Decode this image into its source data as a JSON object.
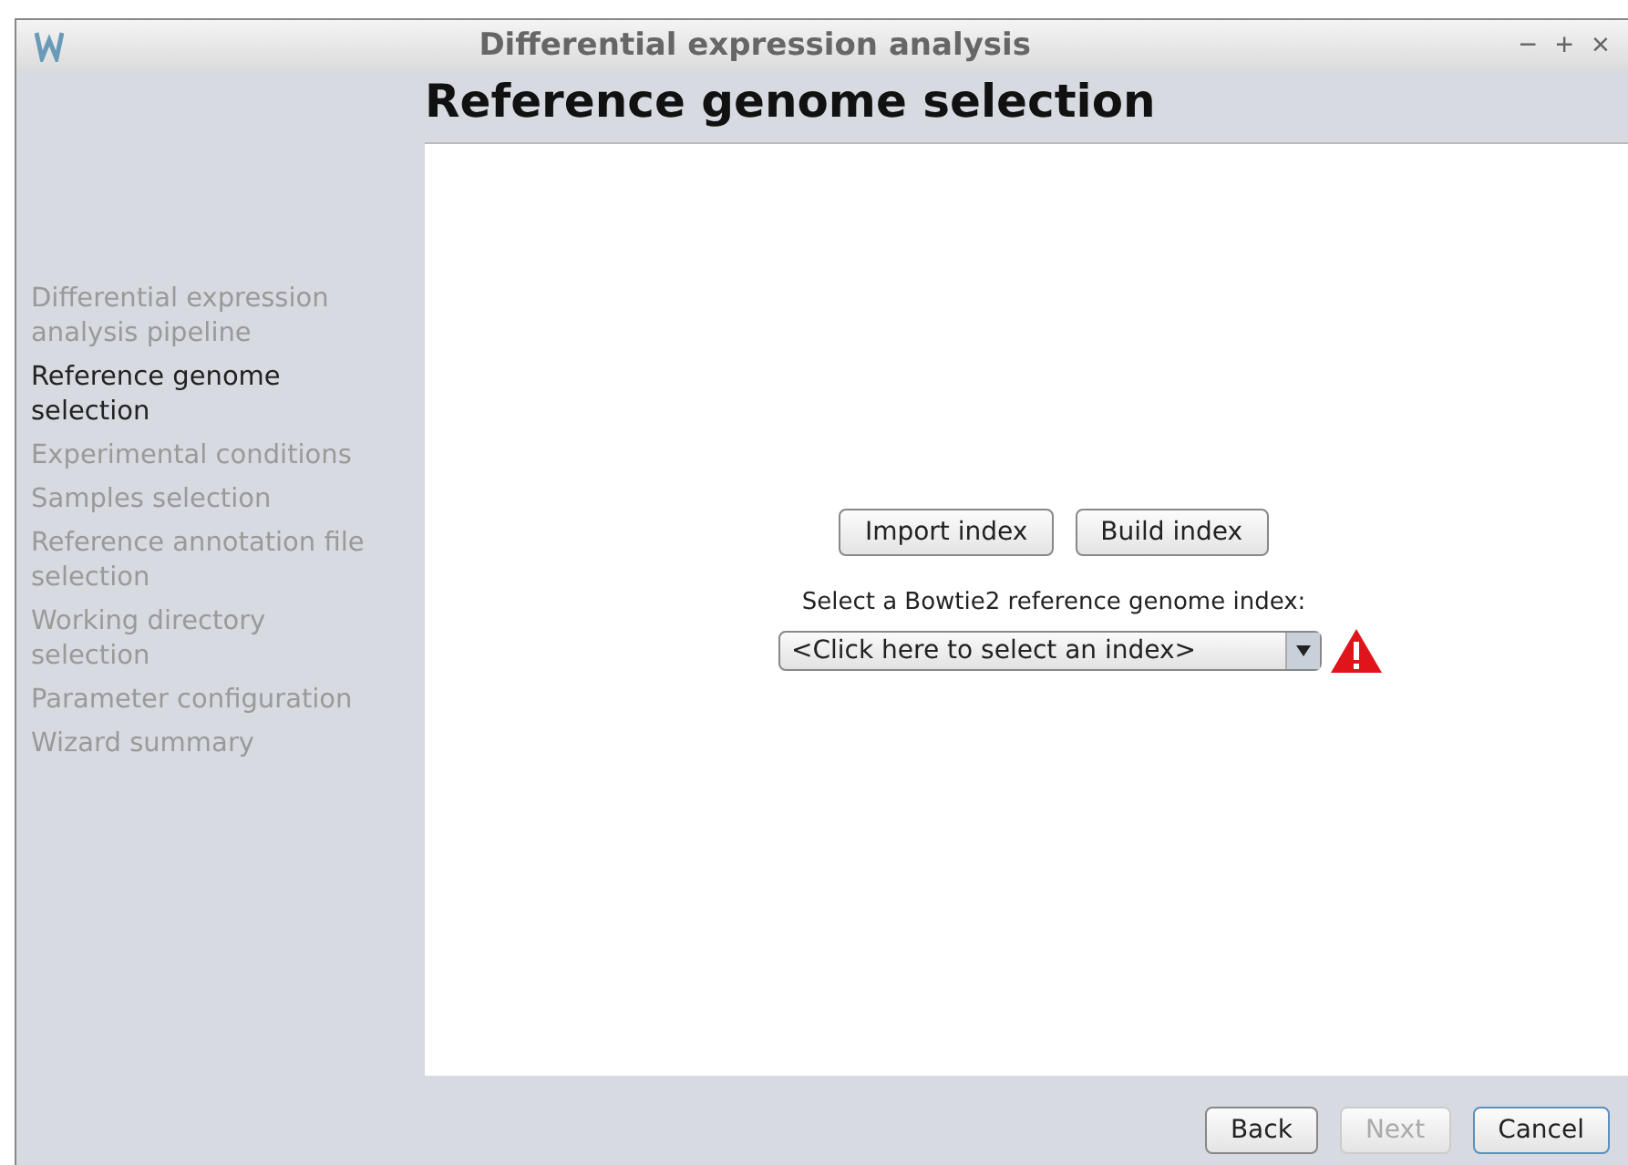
{
  "window": {
    "title": "Differential expression analysis",
    "controls": [
      "−",
      "+",
      "×"
    ]
  },
  "heading": "Reference genome selection",
  "steps": [
    {
      "label": "Differential expression analysis pipeline",
      "selected": false
    },
    {
      "label": "Reference genome selection",
      "selected": true
    },
    {
      "label": "Experimental conditions",
      "selected": false
    },
    {
      "label": "Samples selection",
      "selected": false
    },
    {
      "label": "Reference annotation file selection",
      "selected": false
    },
    {
      "label": "Working directory selection",
      "selected": false
    },
    {
      "label": "Parameter configuration",
      "selected": false
    },
    {
      "label": "Wizard summary",
      "selected": false
    }
  ],
  "actions": [
    "Import index",
    "Build index"
  ],
  "index_label": "Select a Bowtie2 reference genome index:",
  "index_select": {
    "value": "<Click here to select an index>",
    "warning": true
  },
  "footer_buttons": [
    {
      "label": "Back",
      "disabled": false,
      "focused": false
    },
    {
      "label": "Next",
      "disabled": true,
      "focused": false
    },
    {
      "label": "Cancel",
      "disabled": false,
      "focused": true
    }
  ]
}
